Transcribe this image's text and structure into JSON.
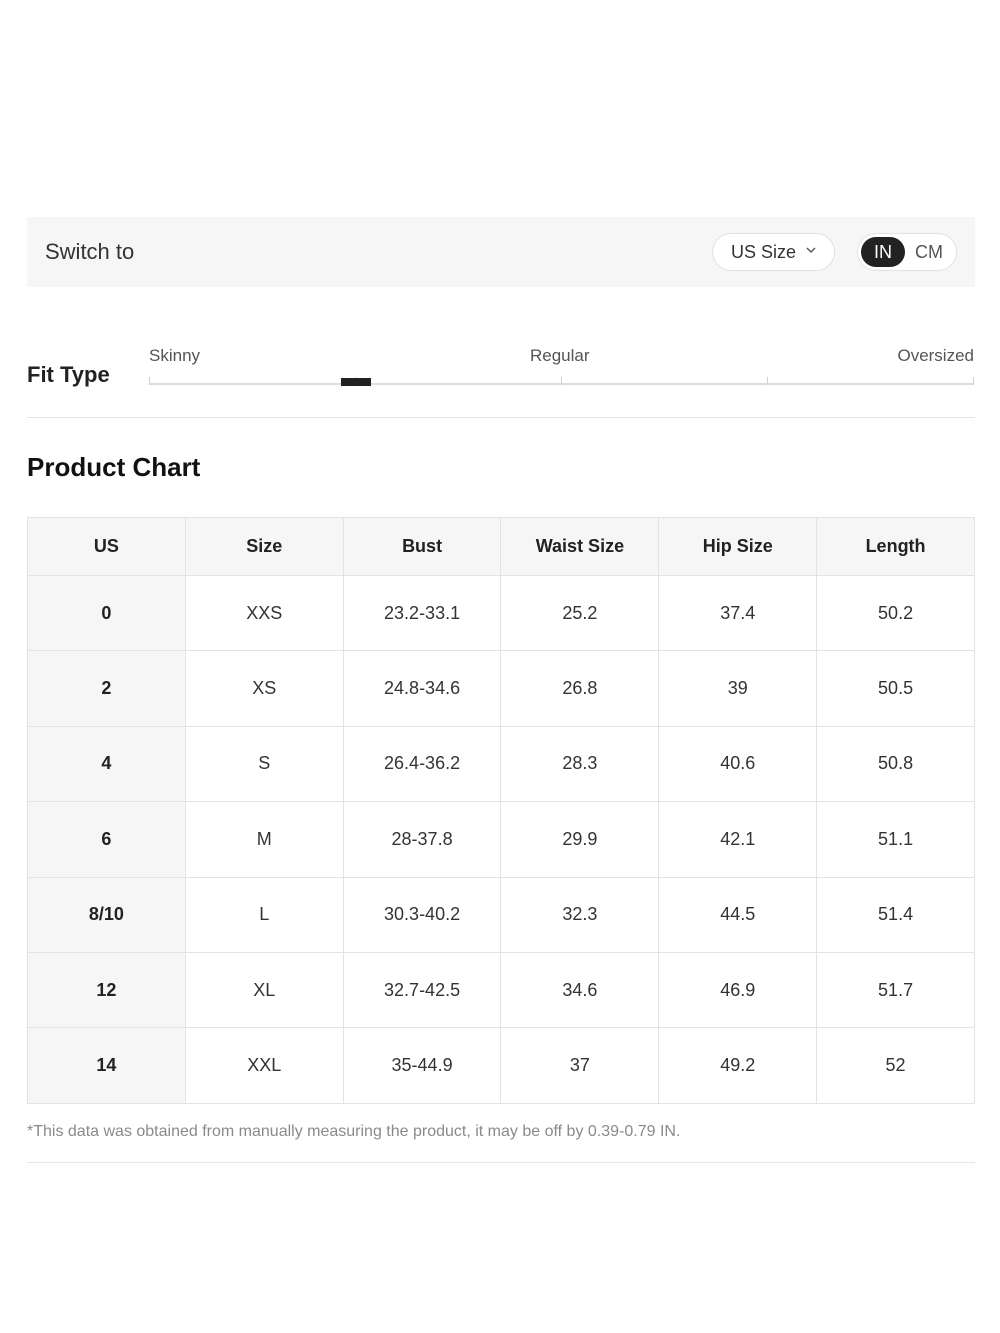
{
  "switch_bar": {
    "label": "Switch to",
    "size_system": "US Size",
    "units": [
      "IN",
      "CM"
    ],
    "active_unit": "IN"
  },
  "fit_type": {
    "title": "Fit Type",
    "scale_labels": [
      "Skinny",
      "Regular",
      "Oversized"
    ],
    "position": 0.25
  },
  "product_chart": {
    "title": "Product Chart",
    "columns": [
      "US",
      "Size",
      "Bust",
      "Waist Size",
      "Hip Size",
      "Length"
    ],
    "rows": [
      [
        "0",
        "XXS",
        "23.2-33.1",
        "25.2",
        "37.4",
        "50.2"
      ],
      [
        "2",
        "XS",
        "24.8-34.6",
        "26.8",
        "39",
        "50.5"
      ],
      [
        "4",
        "S",
        "26.4-36.2",
        "28.3",
        "40.6",
        "50.8"
      ],
      [
        "6",
        "M",
        "28-37.8",
        "29.9",
        "42.1",
        "51.1"
      ],
      [
        "8/10",
        "L",
        "30.3-40.2",
        "32.3",
        "44.5",
        "51.4"
      ],
      [
        "12",
        "XL",
        "32.7-42.5",
        "34.6",
        "46.9",
        "51.7"
      ],
      [
        "14",
        "XXL",
        "35-44.9",
        "37",
        "49.2",
        "52"
      ]
    ],
    "note": "*This data was obtained from manually measuring the product, it may be off by 0.39-0.79 IN."
  }
}
